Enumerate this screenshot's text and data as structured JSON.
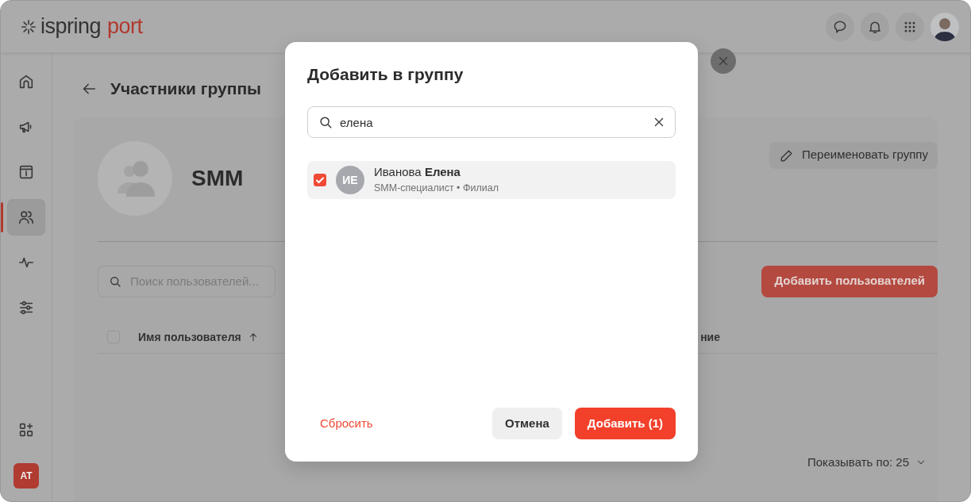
{
  "header": {
    "logo": {
      "brand": "ispring",
      "product": "port"
    }
  },
  "sidebar": {
    "items": [
      {
        "selected": false
      },
      {
        "selected": false
      },
      {
        "selected": false
      },
      {
        "selected": true
      },
      {
        "selected": false
      },
      {
        "selected": false
      }
    ],
    "user_initials": "AT"
  },
  "page": {
    "title": "Участники группы",
    "group_name": "SMM",
    "rename_button": "Переименовать группу",
    "search": {
      "placeholder": "Поиск пользователей..."
    },
    "add_users_button": "Добавить пользователей",
    "table": {
      "columns": [
        {
          "label": "Имя пользователя",
          "sorted": true
        },
        {
          "label": "ние"
        }
      ],
      "select_all": false
    },
    "page_size": {
      "label": "Показывать по: 25"
    }
  },
  "modal": {
    "title": "Добавить в группу",
    "search": {
      "value": "елена"
    },
    "results": [
      {
        "initials": "ИЕ",
        "name": "Иванова **Елена**",
        "details": "SMM-специалист • Филиал",
        "checked": true
      }
    ],
    "reset_button": "Сбросить",
    "cancel_button": "Отмена",
    "add_button": "Добавить (1)"
  }
}
